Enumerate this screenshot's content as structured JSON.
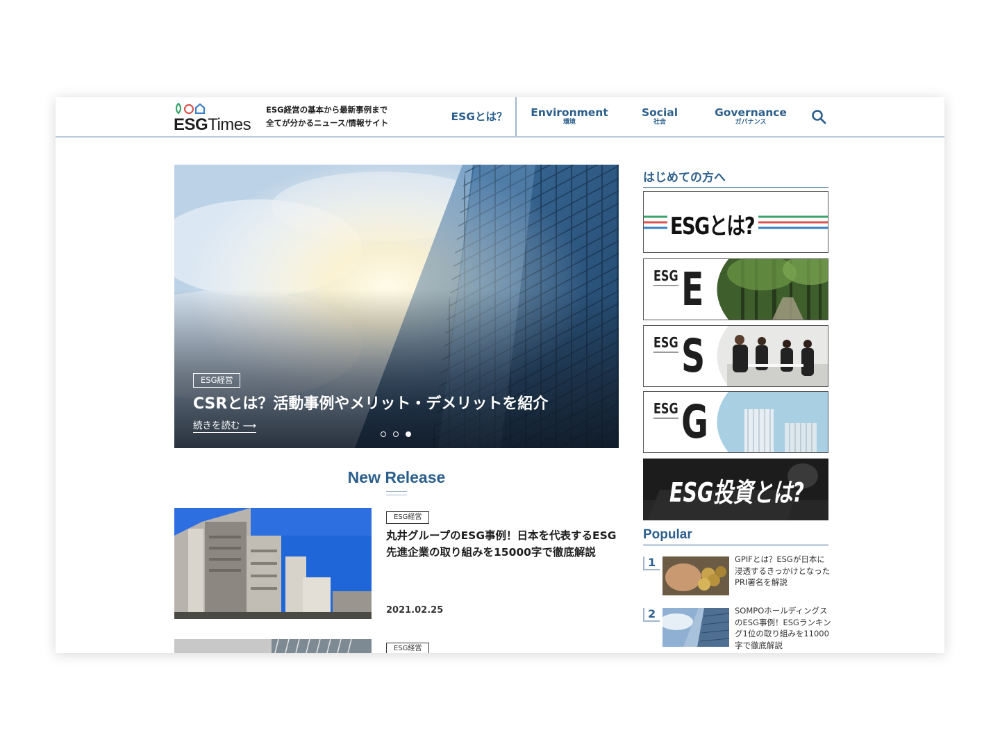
{
  "header": {
    "logo_bold": "ESG",
    "logo_light": "Times",
    "tagline_line1": "ESG経営の基本から最新事例まで",
    "tagline_line2": "全てが分かるニュース/情報サイト",
    "nav": [
      {
        "main": "ESGとは？",
        "sub": ""
      },
      {
        "main": "Environment",
        "sub": "環境"
      },
      {
        "main": "Social",
        "sub": "社会"
      },
      {
        "main": "Governance",
        "sub": "ガバナンス"
      }
    ],
    "accent": "#2c5f8c"
  },
  "hero": {
    "tag": "ESG経営",
    "title": "CSRとは？活動事例やメリット・デメリットを紹介",
    "more": "続きを読む ⟶",
    "slides": 3,
    "active_slide": 3
  },
  "new_release": {
    "title": "New Release",
    "articles": [
      {
        "tag": "ESG経営",
        "title": "丸井グループのESG事例！日本を代表するESG先進企業の取り組みを15000字で徹底解説",
        "date": "2021.02.25"
      },
      {
        "tag": "ESG経営",
        "title": "",
        "date": ""
      }
    ]
  },
  "sidebar": {
    "intro_title": "はじめての方へ",
    "banners": [
      {
        "label": "ESGとは?"
      },
      {
        "prefix": "ESG",
        "letter": "E"
      },
      {
        "prefix": "ESG",
        "letter": "S"
      },
      {
        "prefix": "ESG",
        "letter": "G"
      },
      {
        "label": "ESG投資とは?"
      }
    ],
    "popular_title": "Popular",
    "popular": [
      {
        "rank": "1",
        "text": "GPIFとは？ESGが日本に浸透するきっかけとなったPRI署名を解説"
      },
      {
        "rank": "2",
        "text": "SOMPOホールディングスのESG事例！ESGランキング1位の取り組みを11000字で徹底解説"
      }
    ]
  },
  "colors": {
    "brand_green": "#3aa36b",
    "brand_red": "#d9534f",
    "brand_blue": "#3b7fc4"
  }
}
